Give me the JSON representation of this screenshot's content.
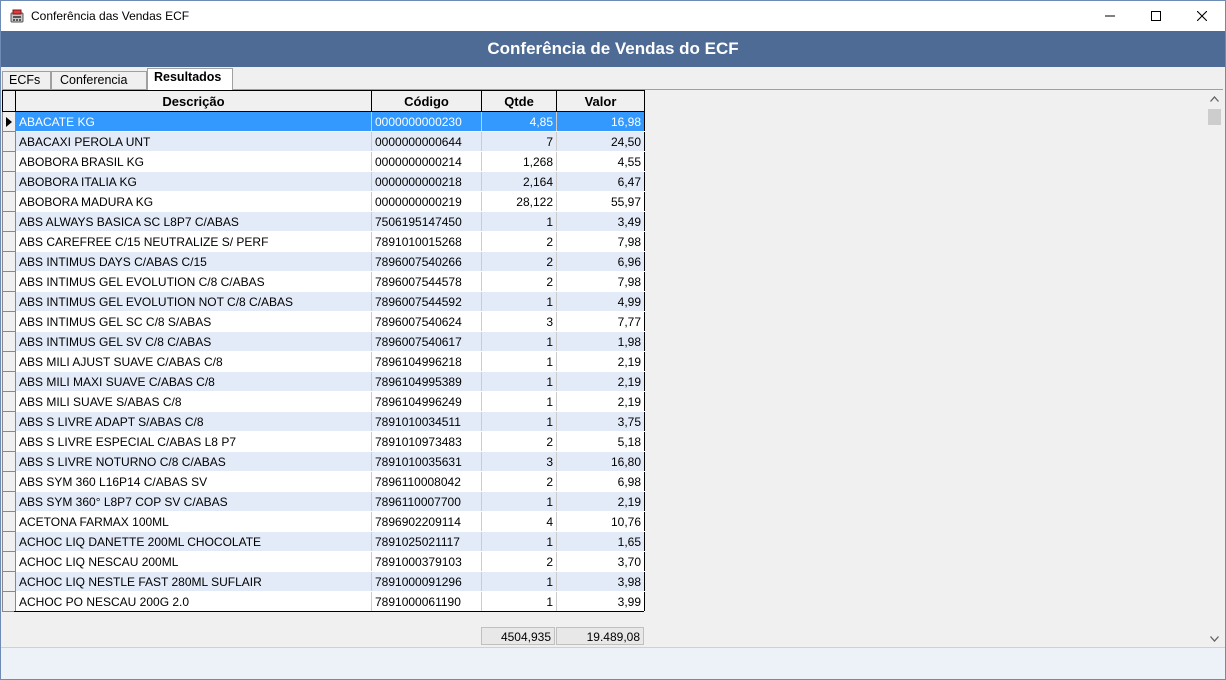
{
  "window": {
    "title": "Conferência das Vendas ECF"
  },
  "banner": {
    "title": "Conferência de Vendas do ECF"
  },
  "tabs": [
    {
      "label": "ECFs"
    },
    {
      "label": "Conferencia"
    },
    {
      "label": "Resultados",
      "active": true
    }
  ],
  "grid": {
    "columns": [
      "Descrição",
      "Código",
      "Qtde",
      "Valor"
    ],
    "selected_row": 0,
    "rows": [
      [
        "ABACATE KG",
        "0000000000230",
        "4,85",
        "16,98"
      ],
      [
        "ABACAXI PEROLA UNT",
        "0000000000644",
        "7",
        "24,50"
      ],
      [
        "ABOBORA BRASIL KG",
        "0000000000214",
        "1,268",
        "4,55"
      ],
      [
        "ABOBORA ITALIA KG",
        "0000000000218",
        "2,164",
        "6,47"
      ],
      [
        "ABOBORA MADURA KG",
        "0000000000219",
        "28,122",
        "55,97"
      ],
      [
        "ABS ALWAYS BASICA SC L8P7 C/ABAS",
        "7506195147450",
        "1",
        "3,49"
      ],
      [
        "ABS CAREFREE C/15 NEUTRALIZE S/ PERF",
        "7891010015268",
        "2",
        "7,98"
      ],
      [
        "ABS INTIMUS DAYS C/ABAS C/15",
        "7896007540266",
        "2",
        "6,96"
      ],
      [
        "ABS INTIMUS GEL EVOLUTION  C/8 C/ABAS",
        "7896007544578",
        "2",
        "7,98"
      ],
      [
        "ABS INTIMUS GEL EVOLUTION NOT C/8 C/ABAS",
        "7896007544592",
        "1",
        "4,99"
      ],
      [
        "ABS INTIMUS GEL SC C/8 S/ABAS",
        "7896007540624",
        "3",
        "7,77"
      ],
      [
        "ABS INTIMUS GEL SV C/8 C/ABAS",
        "7896007540617",
        "1",
        "1,98"
      ],
      [
        "ABS MILI AJUST SUAVE C/ABAS C/8",
        "7896104996218",
        "1",
        "2,19"
      ],
      [
        "ABS MILI MAXI SUAVE C/ABAS C/8",
        "7896104995389",
        "1",
        "2,19"
      ],
      [
        "ABS MILI SUAVE S/ABAS C/8",
        "7896104996249",
        "1",
        "2,19"
      ],
      [
        "ABS S LIVRE ADAPT S/ABAS C/8",
        "7891010034511",
        "1",
        "3,75"
      ],
      [
        "ABS S LIVRE ESPECIAL C/ABAS L8 P7",
        "7891010973483",
        "2",
        "5,18"
      ],
      [
        "ABS S LIVRE NOTURNO C/8 C/ABAS",
        "7891010035631",
        "3",
        "16,80"
      ],
      [
        "ABS SYM 360 L16P14 C/ABAS SV",
        "7896110008042",
        "2",
        "6,98"
      ],
      [
        "ABS SYM 360° L8P7 COP SV C/ABAS",
        "7896110007700",
        "1",
        "2,19"
      ],
      [
        "ACETONA FARMAX 100ML",
        "7896902209114",
        "4",
        "10,76"
      ],
      [
        "ACHOC LIQ DANETTE 200ML CHOCOLATE",
        "7891025021117",
        "1",
        "1,65"
      ],
      [
        "ACHOC LIQ NESCAU 200ML",
        "7891000379103",
        "2",
        "3,70"
      ],
      [
        "ACHOC LIQ NESTLE FAST 280ML SUFLAIR",
        "7891000091296",
        "1",
        "3,98"
      ],
      [
        "ACHOC PO NESCAU 200G 2.0",
        "7891000061190",
        "1",
        "3,99"
      ]
    ],
    "totals": {
      "qtde": "4504,935",
      "valor": "19.489,08"
    }
  },
  "colors": {
    "banner": "#4e6b95",
    "selection": "#3399ff",
    "alt_row": "#e4ebf8"
  },
  "icons": [
    "app-icon",
    "minimize-icon",
    "maximize-icon",
    "close-icon",
    "row-pointer-icon",
    "scroll-up-icon",
    "scroll-down-icon"
  ]
}
